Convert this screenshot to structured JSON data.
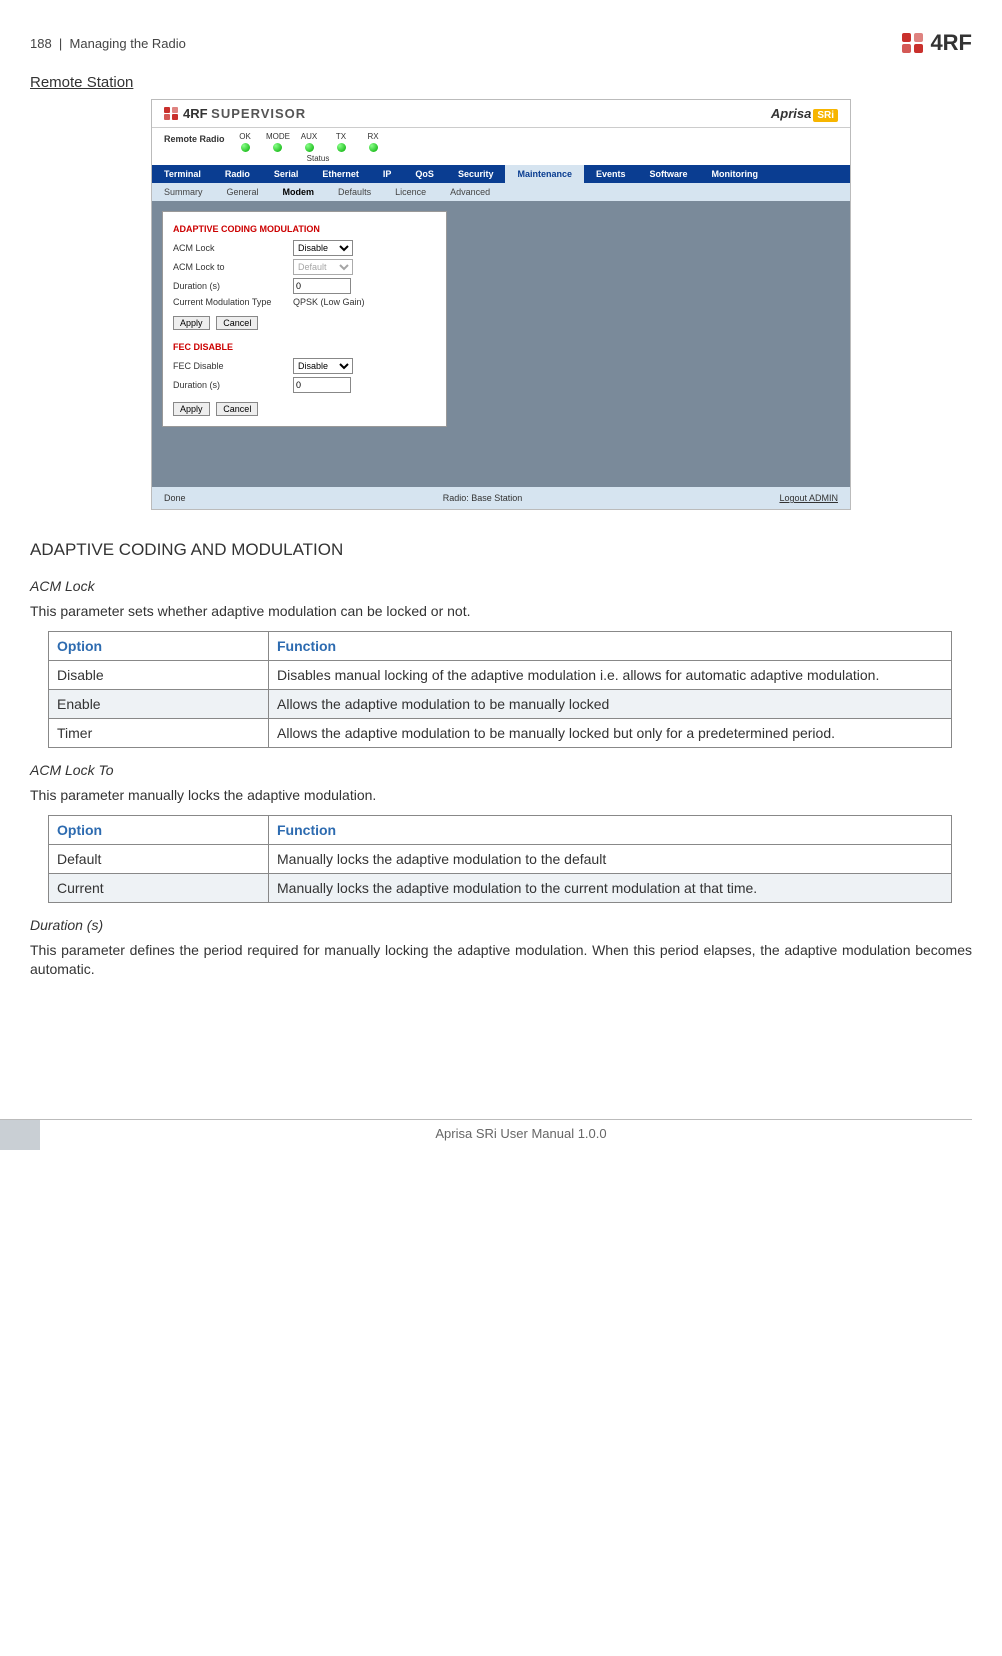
{
  "header": {
    "page_num": "188",
    "breadcrumb": "Managing the Radio",
    "logo_text": "4RF"
  },
  "sections": {
    "remote_station": "Remote Station",
    "acm_heading": "ADAPTIVE CODING AND MODULATION",
    "acm_lock": {
      "title": "ACM Lock",
      "desc": "This parameter sets whether adaptive modulation can be locked or not."
    },
    "acm_lock_to": {
      "title": "ACM Lock To",
      "desc": "This parameter manually locks the adaptive modulation."
    },
    "duration": {
      "title": "Duration (s)",
      "desc": "This parameter defines the period required for manually locking the adaptive modulation. When this period elapses, the adaptive modulation becomes automatic."
    }
  },
  "columns": {
    "option": "Option",
    "function": "Function"
  },
  "table1": [
    {
      "opt": "Disable",
      "fn": "Disables manual locking of the adaptive modulation i.e. allows for automatic adaptive modulation."
    },
    {
      "opt": "Enable",
      "fn": "Allows the adaptive modulation to be manually locked"
    },
    {
      "opt": "Timer",
      "fn": "Allows the adaptive modulation to be manually locked but only for a predetermined period."
    }
  ],
  "table2": [
    {
      "opt": "Default",
      "fn": "Manually locks the adaptive modulation to the default"
    },
    {
      "opt": "Current",
      "fn": "Manually locks the adaptive modulation to the current modulation at that time."
    }
  ],
  "screenshot": {
    "supervisor": "SUPERVISOR",
    "aprisa": "Aprisa",
    "sri": "SRi",
    "remote_radio": "Remote Radio",
    "leds": [
      "OK",
      "MODE",
      "AUX",
      "TX",
      "RX"
    ],
    "status_label": "Status",
    "nav_main": [
      "Terminal",
      "Radio",
      "Serial",
      "Ethernet",
      "IP",
      "QoS",
      "Security",
      "Maintenance",
      "Events",
      "Software",
      "Monitoring"
    ],
    "nav_main_active": "Maintenance",
    "nav_sub": [
      "Summary",
      "General",
      "Modem",
      "Defaults",
      "Licence",
      "Advanced"
    ],
    "nav_sub_active": "Modem",
    "acm_section": "ADAPTIVE CODING MODULATION",
    "fields": {
      "acm_lock_label": "ACM Lock",
      "acm_lock_value": "Disable",
      "acm_lock_to_label": "ACM Lock to",
      "acm_lock_to_value": "Default",
      "duration_label": "Duration (s)",
      "duration_value": "0",
      "cmt_label": "Current Modulation Type",
      "cmt_value": "QPSK (Low Gain)"
    },
    "fec_section": "FEC DISABLE",
    "fec_fields": {
      "fec_disable_label": "FEC Disable",
      "fec_disable_value": "Disable",
      "duration_label": "Duration (s)",
      "duration_value": "0"
    },
    "buttons": {
      "apply": "Apply",
      "cancel": "Cancel"
    },
    "footer": {
      "done": "Done",
      "radio": "Radio: Base Station",
      "logout": "Logout ADMIN"
    }
  },
  "footer_text": "Aprisa SRi User Manual 1.0.0"
}
